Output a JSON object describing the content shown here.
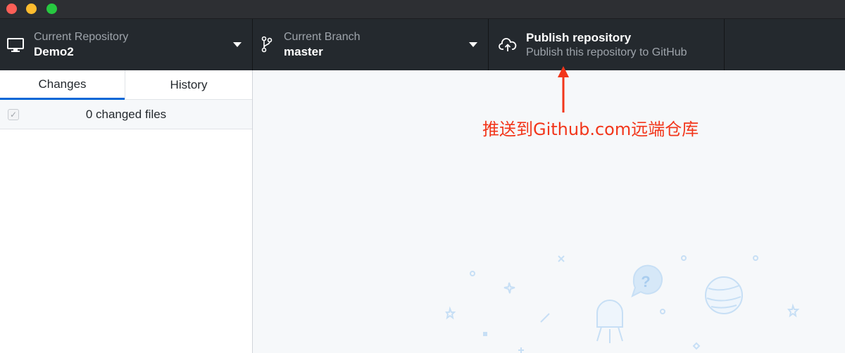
{
  "window": {
    "traffic_lights": {
      "close_color": "#fd5f57",
      "minimize_color": "#febc2e",
      "maximize_color": "#27c840"
    }
  },
  "toolbar": {
    "repository": {
      "label": "Current Repository",
      "value": "Demo2",
      "icon": "desktop-computer-icon"
    },
    "branch": {
      "label": "Current Branch",
      "value": "master",
      "icon": "git-branch-icon"
    },
    "publish": {
      "title": "Publish repository",
      "subtitle": "Publish this repository to GitHub",
      "icon": "cloud-upload-icon"
    }
  },
  "sidebar": {
    "tabs": [
      {
        "label": "Changes",
        "active": true
      },
      {
        "label": "History",
        "active": false
      }
    ],
    "changes_summary": "0 changed files"
  },
  "annotation": {
    "text": "推送到Github.com远端仓库",
    "color": "#f2361b"
  },
  "colors": {
    "toolbar_bg": "#24292e",
    "accent": "#0366d6",
    "background": "#f6f8fa"
  }
}
